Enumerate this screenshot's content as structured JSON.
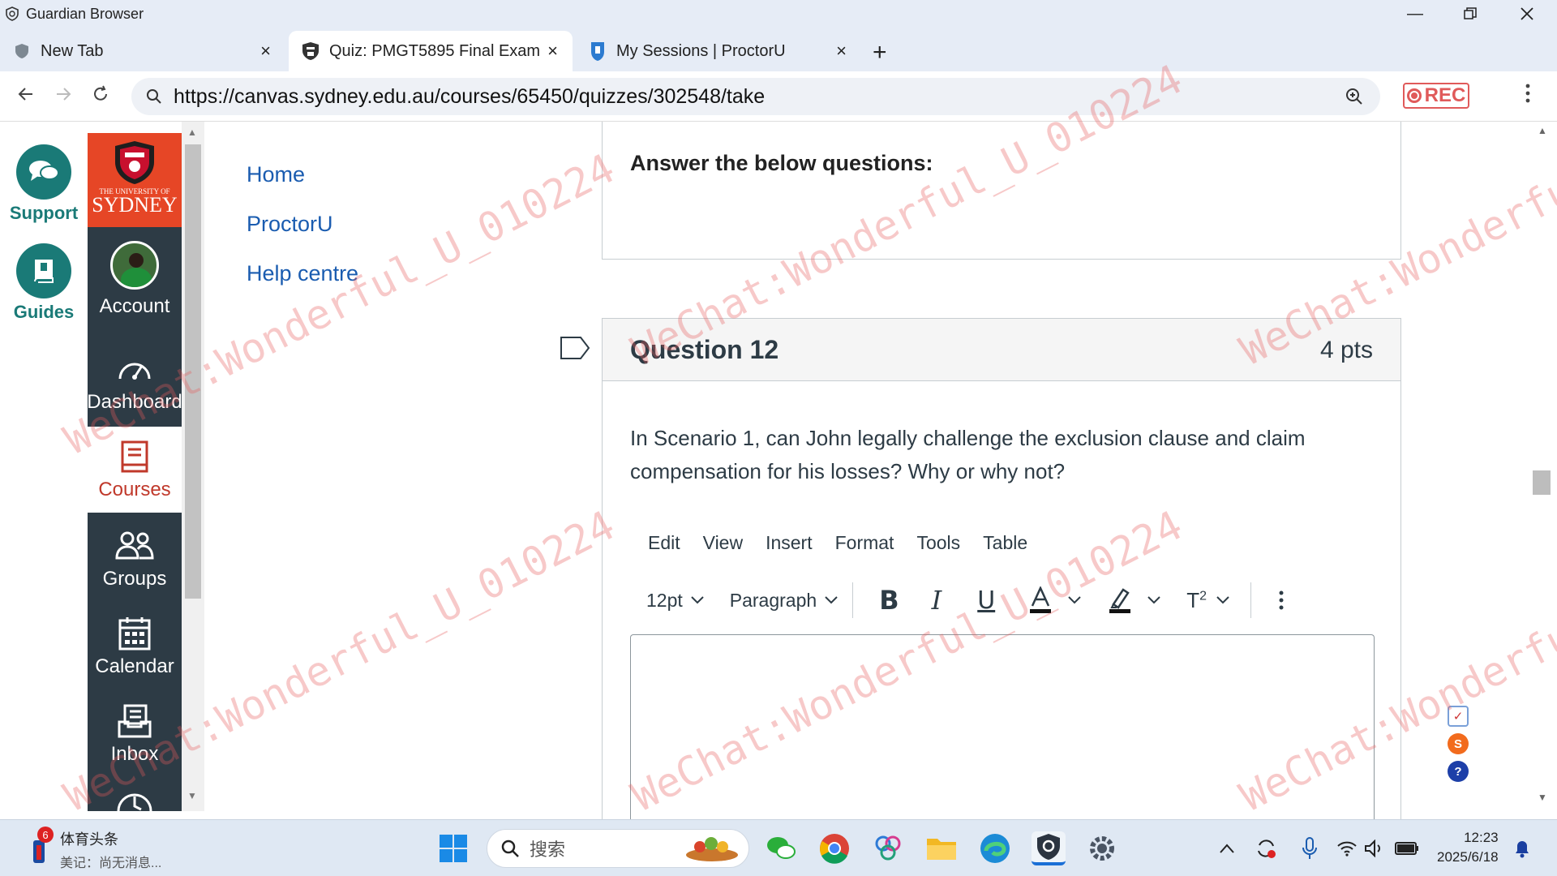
{
  "window": {
    "title": "Guardian Browser"
  },
  "tabs": [
    {
      "label": "New Tab"
    },
    {
      "label": "Quiz: PMGT5895 Final Exam"
    },
    {
      "label": "My Sessions | ProctorU"
    }
  ],
  "address": {
    "url": "https://canvas.sydney.edu.au/courses/65450/quizzes/302548/take",
    "rec_label": "REC"
  },
  "rail": {
    "support_label": "Support",
    "guides_label": "Guides"
  },
  "global_nav": {
    "logo_text_small": "THE UNIVERSITY OF",
    "logo_text": "SYDNEY",
    "items": [
      {
        "label": "Account"
      },
      {
        "label": "Dashboard"
      },
      {
        "label": "Courses"
      },
      {
        "label": "Groups"
      },
      {
        "label": "Calendar"
      },
      {
        "label": "Inbox"
      }
    ]
  },
  "course_nav": {
    "items": [
      {
        "label": "Home"
      },
      {
        "label": "ProctorU"
      },
      {
        "label": "Help centre"
      }
    ]
  },
  "content": {
    "intro": "Answer the below questions:",
    "question_title": "Question 12",
    "question_points": "4 pts",
    "question_text": "In Scenario 1, can John legally challenge the exclusion clause and claim compensation for his losses? Why or why not?",
    "editor_menu": [
      "Edit",
      "View",
      "Insert",
      "Format",
      "Tools",
      "Table"
    ],
    "font_size": "12pt",
    "block_format": "Paragraph"
  },
  "watermark": {
    "text": "WeChat:Wonderful_U_010224"
  },
  "taskbar": {
    "news_badge": "6",
    "news_title": "体育头条",
    "news_sub": "美记：尚无消息...",
    "search_placeholder": "搜索",
    "time": "12:23",
    "date": "2025/6/18"
  },
  "colors": {
    "canvas_nav": "#2d3b45",
    "sydney_red": "#e64626",
    "link_blue": "#1a5cb0",
    "support_teal": "#1a7a77"
  }
}
